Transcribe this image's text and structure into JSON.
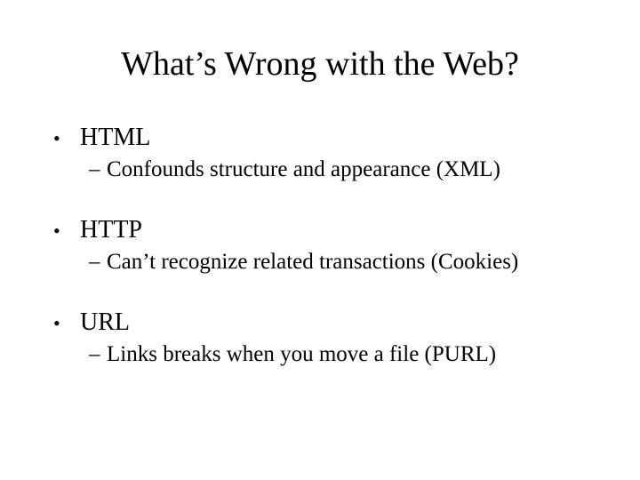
{
  "title": "What’s Wrong with the Web?",
  "items": [
    {
      "label": "HTML",
      "sub": "Confounds structure and appearance (XML)"
    },
    {
      "label": "HTTP",
      "sub": "Can’t recognize related transactions (Cookies)"
    },
    {
      "label": "URL",
      "sub": "Links breaks when you move a file (PURL)"
    }
  ]
}
